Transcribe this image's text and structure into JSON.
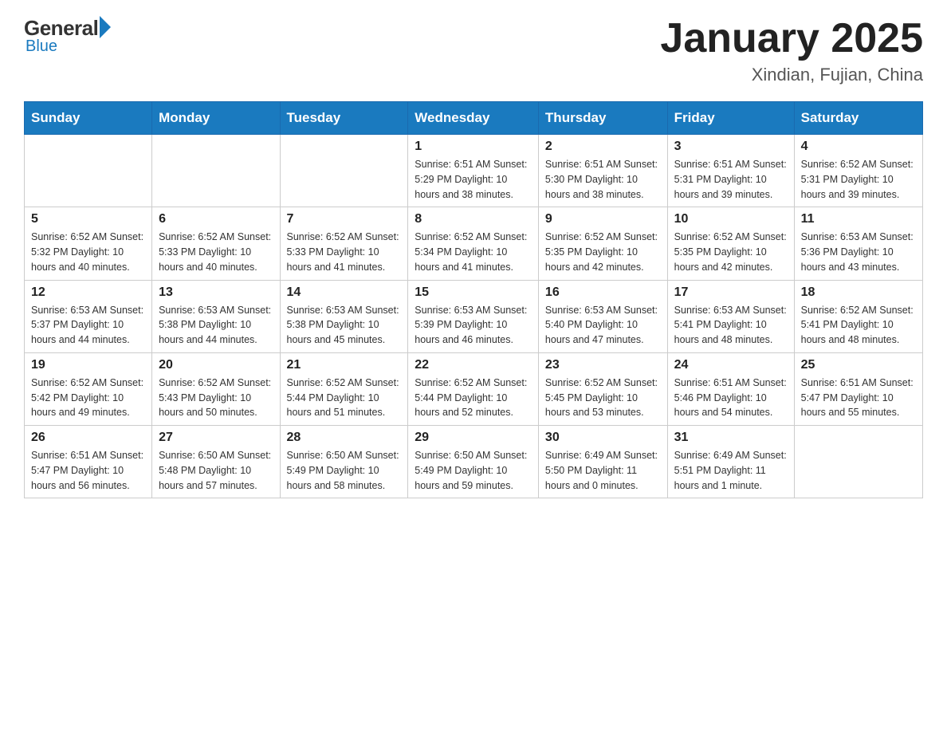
{
  "logo": {
    "general": "General",
    "blue": "Blue",
    "subtitle": "Blue"
  },
  "header": {
    "month_year": "January 2025",
    "location": "Xindian, Fujian, China"
  },
  "days_of_week": [
    "Sunday",
    "Monday",
    "Tuesday",
    "Wednesday",
    "Thursday",
    "Friday",
    "Saturday"
  ],
  "weeks": [
    [
      {
        "day": "",
        "info": ""
      },
      {
        "day": "",
        "info": ""
      },
      {
        "day": "",
        "info": ""
      },
      {
        "day": "1",
        "info": "Sunrise: 6:51 AM\nSunset: 5:29 PM\nDaylight: 10 hours\nand 38 minutes."
      },
      {
        "day": "2",
        "info": "Sunrise: 6:51 AM\nSunset: 5:30 PM\nDaylight: 10 hours\nand 38 minutes."
      },
      {
        "day": "3",
        "info": "Sunrise: 6:51 AM\nSunset: 5:31 PM\nDaylight: 10 hours\nand 39 minutes."
      },
      {
        "day": "4",
        "info": "Sunrise: 6:52 AM\nSunset: 5:31 PM\nDaylight: 10 hours\nand 39 minutes."
      }
    ],
    [
      {
        "day": "5",
        "info": "Sunrise: 6:52 AM\nSunset: 5:32 PM\nDaylight: 10 hours\nand 40 minutes."
      },
      {
        "day": "6",
        "info": "Sunrise: 6:52 AM\nSunset: 5:33 PM\nDaylight: 10 hours\nand 40 minutes."
      },
      {
        "day": "7",
        "info": "Sunrise: 6:52 AM\nSunset: 5:33 PM\nDaylight: 10 hours\nand 41 minutes."
      },
      {
        "day": "8",
        "info": "Sunrise: 6:52 AM\nSunset: 5:34 PM\nDaylight: 10 hours\nand 41 minutes."
      },
      {
        "day": "9",
        "info": "Sunrise: 6:52 AM\nSunset: 5:35 PM\nDaylight: 10 hours\nand 42 minutes."
      },
      {
        "day": "10",
        "info": "Sunrise: 6:52 AM\nSunset: 5:35 PM\nDaylight: 10 hours\nand 42 minutes."
      },
      {
        "day": "11",
        "info": "Sunrise: 6:53 AM\nSunset: 5:36 PM\nDaylight: 10 hours\nand 43 minutes."
      }
    ],
    [
      {
        "day": "12",
        "info": "Sunrise: 6:53 AM\nSunset: 5:37 PM\nDaylight: 10 hours\nand 44 minutes."
      },
      {
        "day": "13",
        "info": "Sunrise: 6:53 AM\nSunset: 5:38 PM\nDaylight: 10 hours\nand 44 minutes."
      },
      {
        "day": "14",
        "info": "Sunrise: 6:53 AM\nSunset: 5:38 PM\nDaylight: 10 hours\nand 45 minutes."
      },
      {
        "day": "15",
        "info": "Sunrise: 6:53 AM\nSunset: 5:39 PM\nDaylight: 10 hours\nand 46 minutes."
      },
      {
        "day": "16",
        "info": "Sunrise: 6:53 AM\nSunset: 5:40 PM\nDaylight: 10 hours\nand 47 minutes."
      },
      {
        "day": "17",
        "info": "Sunrise: 6:53 AM\nSunset: 5:41 PM\nDaylight: 10 hours\nand 48 minutes."
      },
      {
        "day": "18",
        "info": "Sunrise: 6:52 AM\nSunset: 5:41 PM\nDaylight: 10 hours\nand 48 minutes."
      }
    ],
    [
      {
        "day": "19",
        "info": "Sunrise: 6:52 AM\nSunset: 5:42 PM\nDaylight: 10 hours\nand 49 minutes."
      },
      {
        "day": "20",
        "info": "Sunrise: 6:52 AM\nSunset: 5:43 PM\nDaylight: 10 hours\nand 50 minutes."
      },
      {
        "day": "21",
        "info": "Sunrise: 6:52 AM\nSunset: 5:44 PM\nDaylight: 10 hours\nand 51 minutes."
      },
      {
        "day": "22",
        "info": "Sunrise: 6:52 AM\nSunset: 5:44 PM\nDaylight: 10 hours\nand 52 minutes."
      },
      {
        "day": "23",
        "info": "Sunrise: 6:52 AM\nSunset: 5:45 PM\nDaylight: 10 hours\nand 53 minutes."
      },
      {
        "day": "24",
        "info": "Sunrise: 6:51 AM\nSunset: 5:46 PM\nDaylight: 10 hours\nand 54 minutes."
      },
      {
        "day": "25",
        "info": "Sunrise: 6:51 AM\nSunset: 5:47 PM\nDaylight: 10 hours\nand 55 minutes."
      }
    ],
    [
      {
        "day": "26",
        "info": "Sunrise: 6:51 AM\nSunset: 5:47 PM\nDaylight: 10 hours\nand 56 minutes."
      },
      {
        "day": "27",
        "info": "Sunrise: 6:50 AM\nSunset: 5:48 PM\nDaylight: 10 hours\nand 57 minutes."
      },
      {
        "day": "28",
        "info": "Sunrise: 6:50 AM\nSunset: 5:49 PM\nDaylight: 10 hours\nand 58 minutes."
      },
      {
        "day": "29",
        "info": "Sunrise: 6:50 AM\nSunset: 5:49 PM\nDaylight: 10 hours\nand 59 minutes."
      },
      {
        "day": "30",
        "info": "Sunrise: 6:49 AM\nSunset: 5:50 PM\nDaylight: 11 hours\nand 0 minutes."
      },
      {
        "day": "31",
        "info": "Sunrise: 6:49 AM\nSunset: 5:51 PM\nDaylight: 11 hours\nand 1 minute."
      },
      {
        "day": "",
        "info": ""
      }
    ]
  ]
}
